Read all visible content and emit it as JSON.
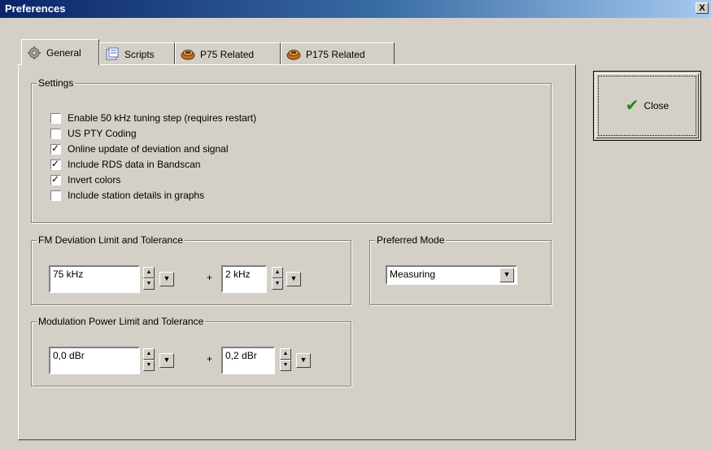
{
  "window": {
    "title": "Preferences",
    "close_glyph": "X"
  },
  "tabs": [
    {
      "label": "General",
      "icon": "gear-icon",
      "active": true
    },
    {
      "label": "Scripts",
      "icon": "scripts-icon",
      "active": false
    },
    {
      "label": "P75 Related",
      "icon": "chip-icon",
      "active": false
    },
    {
      "label": "P175 Related",
      "icon": "chip-icon",
      "active": false
    }
  ],
  "settings": {
    "label": "Settings",
    "options": [
      {
        "label": "Enable 50 kHz tuning step (requires restart)",
        "checked": false
      },
      {
        "label": "US PTY Coding",
        "checked": false
      },
      {
        "label": "Online update of deviation and signal",
        "checked": true
      },
      {
        "label": "Include RDS data in Bandscan",
        "checked": true
      },
      {
        "label": "Invert colors",
        "checked": true
      },
      {
        "label": "Include station details in graphs",
        "checked": false
      }
    ]
  },
  "fm_deviation": {
    "label": "FM Deviation Limit and Tolerance",
    "limit": "75 kHz",
    "plus": "+",
    "tolerance": "2 kHz"
  },
  "modulation_power": {
    "label": "Modulation Power Limit and Tolerance",
    "limit": "0,0 dBr",
    "plus": "+",
    "tolerance": "0,2 dBr"
  },
  "preferred_mode": {
    "label": "Preferred Mode",
    "value": "Measuring"
  },
  "close_button": {
    "label": "Close"
  }
}
